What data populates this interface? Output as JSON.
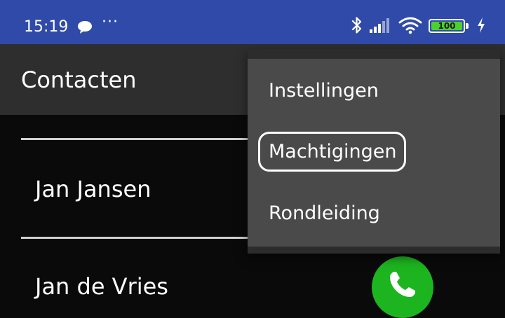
{
  "status_bar": {
    "time": "15:19",
    "chat_icon": "speech-bubble-icon",
    "more_indicator": "···",
    "bluetooth_icon": "bluetooth-icon",
    "signal_icon": "cell-signal-icon",
    "wifi_icon": "wifi-icon",
    "battery_level": "100",
    "charging_icon": "lightning-bolt-icon",
    "color": "#2f4aa8"
  },
  "app_bar": {
    "title": "Contacten",
    "color": "#2e2e2e"
  },
  "contacts": [
    {
      "name": "Jan Jansen"
    },
    {
      "name": "Jan de Vries"
    }
  ],
  "call_button": {
    "icon": "phone-icon",
    "color": "#1db51f"
  },
  "overflow_menu": {
    "items": [
      {
        "label": "Instellingen"
      },
      {
        "label": "Machtigingen",
        "highlighted": true
      },
      {
        "label": "Rondleiding"
      }
    ],
    "color": "#4a4a4a"
  }
}
